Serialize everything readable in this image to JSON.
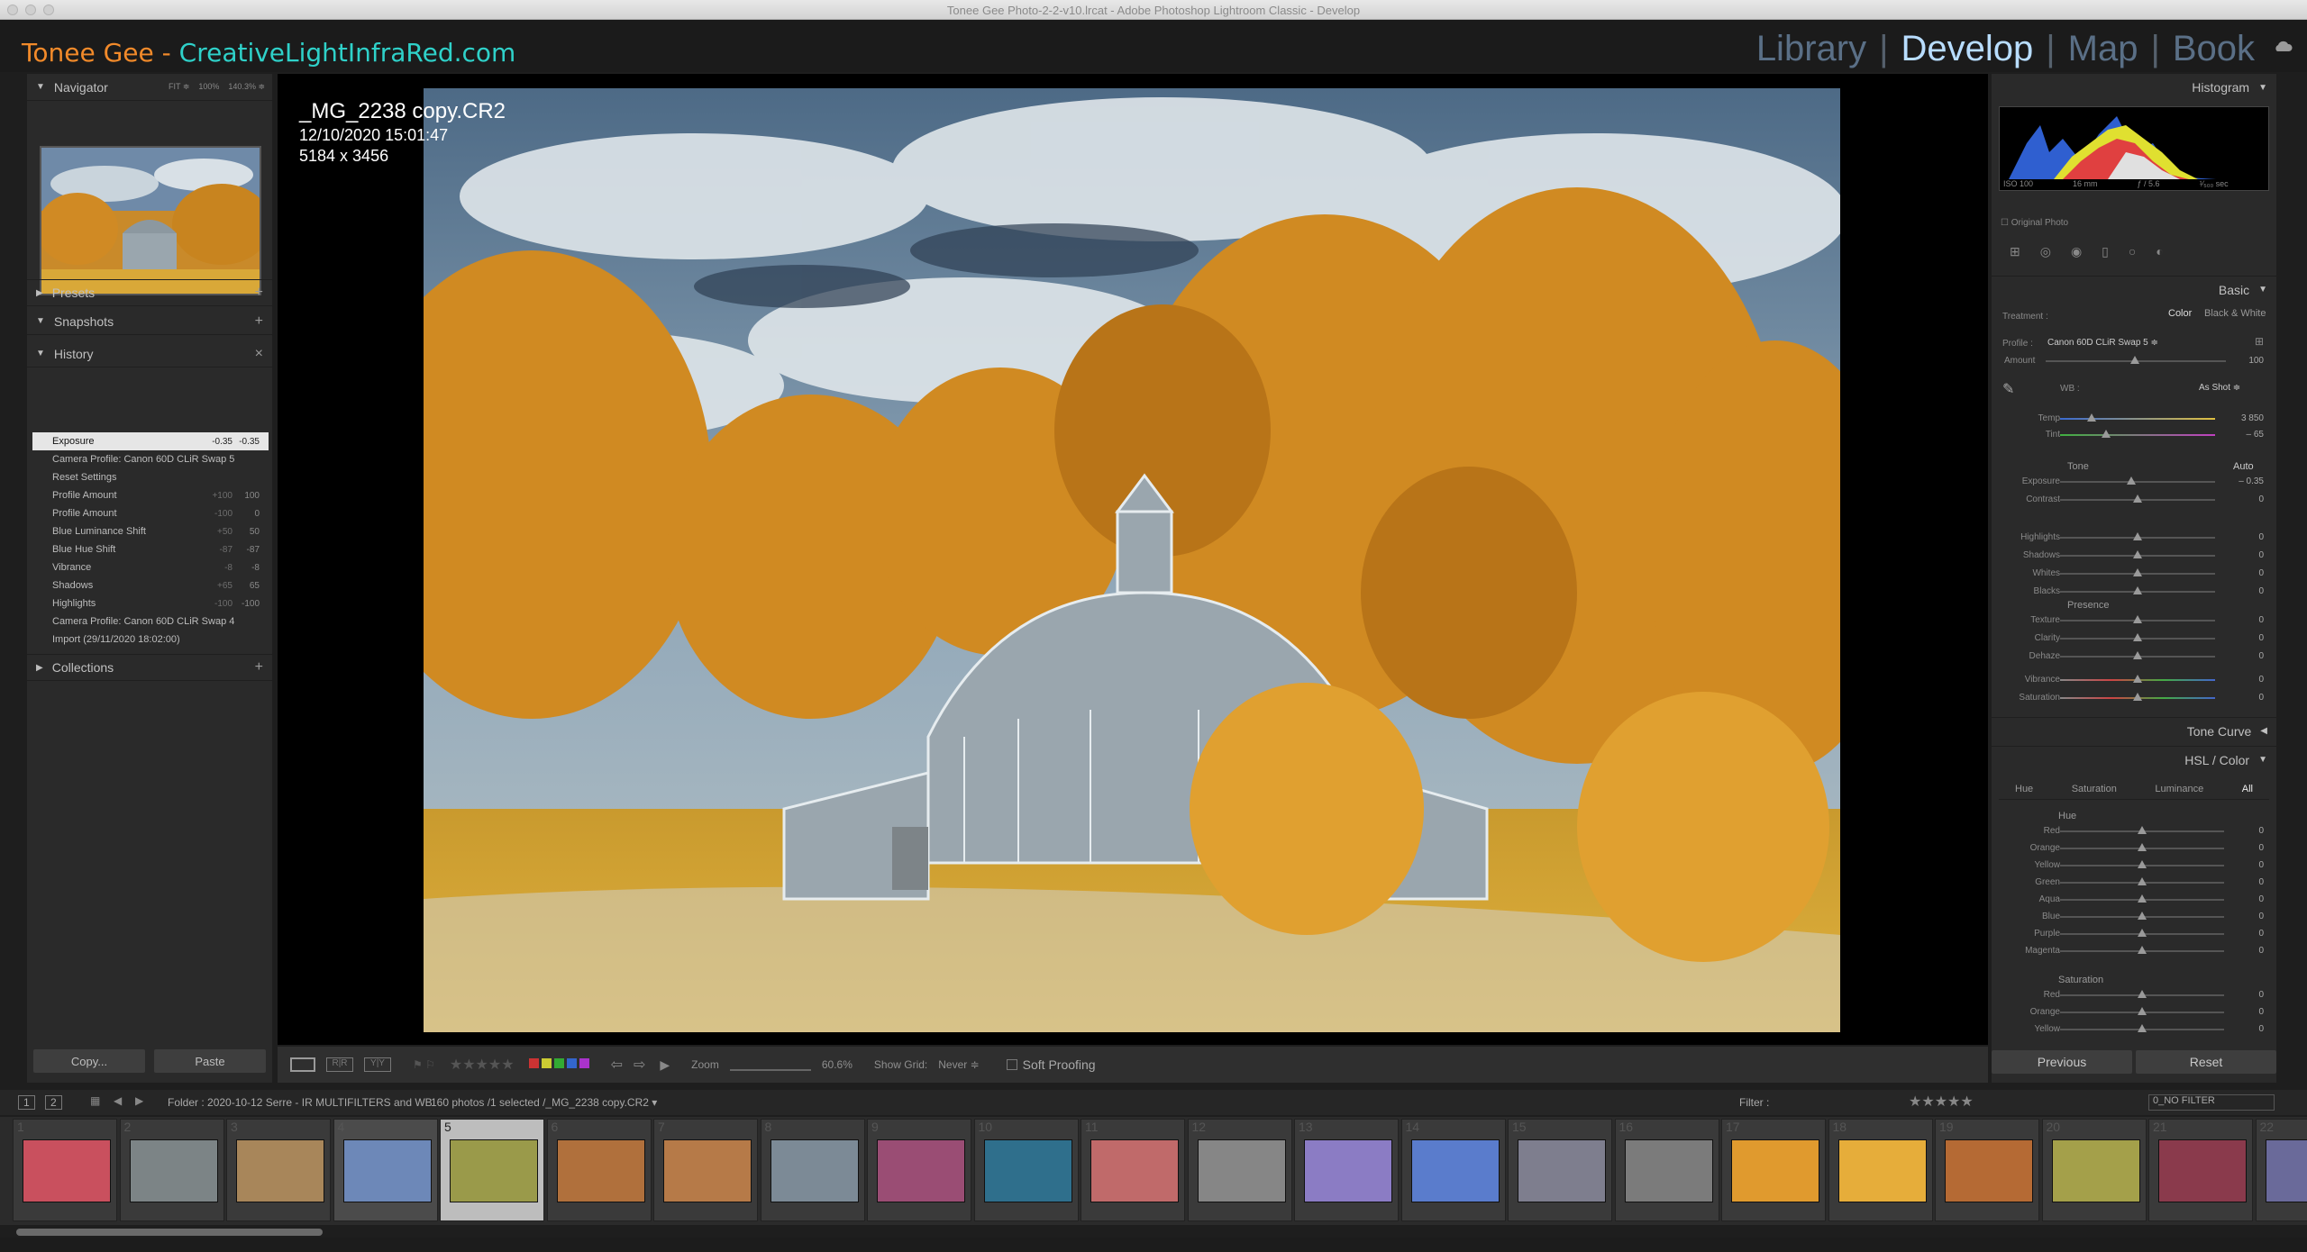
{
  "window": {
    "title": "Tonee Gee Photo-2-2-v10.lrcat - Adobe Photoshop Lightroom Classic - Develop"
  },
  "identity": {
    "brand_a": "Tonee Gee - ",
    "brand_b": "CreativeLightInfraRed.com"
  },
  "modules": {
    "library": "Library",
    "develop": "Develop",
    "map": "Map",
    "book": "Book",
    "active": "Develop"
  },
  "left": {
    "navigator": {
      "label": "Navigator",
      "zoom": [
        "FIT ≑",
        "100%",
        "140.3% ≑"
      ]
    },
    "presets": {
      "label": "Presets"
    },
    "snapshots": {
      "label": "Snapshots"
    },
    "history": {
      "label": "History",
      "items": [
        {
          "name": "Exposure",
          "v1": "-0.35",
          "v2": "-0.35"
        },
        {
          "name": "Camera Profile: Canon 60D CLiR Swap 5",
          "v1": "",
          "v2": ""
        },
        {
          "name": "Reset Settings",
          "v1": "",
          "v2": ""
        },
        {
          "name": "Profile Amount",
          "v1": "+100",
          "v2": "100"
        },
        {
          "name": "Profile Amount",
          "v1": "-100",
          "v2": "0"
        },
        {
          "name": "Blue Luminance Shift",
          "v1": "+50",
          "v2": "50"
        },
        {
          "name": "Blue Hue Shift",
          "v1": "-87",
          "v2": "-87"
        },
        {
          "name": "Vibrance",
          "v1": "-8",
          "v2": "-8"
        },
        {
          "name": "Shadows",
          "v1": "+65",
          "v2": "65"
        },
        {
          "name": "Highlights",
          "v1": "-100",
          "v2": "-100"
        },
        {
          "name": "Camera Profile: Canon 60D CLiR Swap 4",
          "v1": "",
          "v2": ""
        },
        {
          "name": "Import (29/11/2020 18:02:00)",
          "v1": "",
          "v2": ""
        }
      ]
    },
    "collections": {
      "label": "Collections"
    },
    "copy": "Copy...",
    "paste": "Paste"
  },
  "photo": {
    "name": "_MG_2238 copy.CR2",
    "date": "12/10/2020 15:01:47",
    "dims": "5184 x 3456"
  },
  "toolbar": {
    "zoom_label": "Zoom",
    "zoom_value": "60.6%",
    "grid_label": "Show Grid:",
    "grid_value": "Never ≑",
    "soft_proofing": "Soft Proofing"
  },
  "right": {
    "histogram": {
      "label": "Histogram",
      "iso": "ISO 100",
      "focal": "16 mm",
      "aperture": "ƒ / 5.6",
      "shutter": "¹⁄₅₀₀ sec",
      "original": "Original Photo"
    },
    "basic": {
      "label": "Basic",
      "treatment": "Treatment :",
      "color": "Color",
      "bw": "Black & White",
      "profile_label": "Profile :",
      "profile": "Canon 60D CLiR Swap 5 ≑",
      "amount_label": "Amount",
      "amount": "100",
      "wb_label": "WB :",
      "wb": "As Shot ≑",
      "temp_label": "Temp",
      "temp": "3 850",
      "tint_label": "Tint",
      "tint": "– 65",
      "tone": "Tone",
      "auto": "Auto",
      "presence": "Presence",
      "sliders": [
        {
          "label": "Exposure",
          "value": "– 0.35",
          "pos": 0.46
        },
        {
          "label": "Contrast",
          "value": "0",
          "pos": 0.5
        },
        {
          "label": "Highlights",
          "value": "0",
          "pos": 0.5
        },
        {
          "label": "Shadows",
          "value": "0",
          "pos": 0.5
        },
        {
          "label": "Whites",
          "value": "0",
          "pos": 0.5
        },
        {
          "label": "Blacks",
          "value": "0",
          "pos": 0.5
        }
      ],
      "presence_sliders": [
        {
          "label": "Texture",
          "value": "0",
          "pos": 0.5
        },
        {
          "label": "Clarity",
          "value": "0",
          "pos": 0.5
        },
        {
          "label": "Dehaze",
          "value": "0",
          "pos": 0.5
        },
        {
          "label": "Vibrance",
          "value": "0",
          "pos": 0.5
        },
        {
          "label": "Saturation",
          "value": "0",
          "pos": 0.5
        }
      ]
    },
    "tone_curve": {
      "label": "Tone Curve"
    },
    "hsl": {
      "label": "HSL / Color",
      "tabs": [
        "Hue",
        "Saturation",
        "Luminance",
        "All"
      ],
      "hue": "Hue",
      "saturation": "Saturation",
      "hue_sliders": [
        {
          "label": "Red",
          "value": "0",
          "color": "#d44"
        },
        {
          "label": "Orange",
          "value": "0",
          "color": "#d84"
        },
        {
          "label": "Yellow",
          "value": "0",
          "color": "#cc4"
        },
        {
          "label": "Green",
          "value": "0",
          "color": "#4a4"
        },
        {
          "label": "Aqua",
          "value": "0",
          "color": "#4ab"
        },
        {
          "label": "Blue",
          "value": "0",
          "color": "#46c"
        },
        {
          "label": "Purple",
          "value": "0",
          "color": "#84c"
        },
        {
          "label": "Magenta",
          "value": "0",
          "color": "#c4a"
        }
      ],
      "sat_sliders": [
        {
          "label": "Red",
          "value": "0",
          "color": "#d44"
        },
        {
          "label": "Orange",
          "value": "0",
          "color": "#d84"
        },
        {
          "label": "Yellow",
          "value": "0",
          "color": "#cc4"
        }
      ]
    },
    "previous": "Previous",
    "reset": "Reset"
  },
  "filmhdr": {
    "page1": "1",
    "page2": "2",
    "folder": "Folder : 2020-10-12 Serre - IR MULTIFILTERS and WB",
    "count": "160 photos /1 selected /_MG_2238 copy.CR2 ▾",
    "filter": "Filter :",
    "nofilter": "0_NO FILTER"
  },
  "filmstrip": [
    {
      "n": "1",
      "c": "#c9505e"
    },
    {
      "n": "2",
      "c": "#7c8486"
    },
    {
      "n": "3",
      "c": "#a8865a"
    },
    {
      "n": "4",
      "c": "#6d88b8"
    },
    {
      "n": "5",
      "c": "#9a9a4a"
    },
    {
      "n": "6",
      "c": "#b0703c"
    },
    {
      "n": "7",
      "c": "#b67a48"
    },
    {
      "n": "8",
      "c": "#7c8a96"
    },
    {
      "n": "9",
      "c": "#9a4d74"
    },
    {
      "n": "10",
      "c": "#2f6f8c"
    },
    {
      "n": "11",
      "c": "#c06a6a"
    },
    {
      "n": "12",
      "c": "#868686"
    },
    {
      "n": "13",
      "c": "#8b7cc4"
    },
    {
      "n": "14",
      "c": "#5a7ccc"
    },
    {
      "n": "15",
      "c": "#7e7e8e"
    },
    {
      "n": "16",
      "c": "#7b7b7b"
    },
    {
      "n": "17",
      "c": "#e09a2e"
    },
    {
      "n": "18",
      "c": "#e6ad3a"
    },
    {
      "n": "19",
      "c": "#b56a34"
    },
    {
      "n": "20",
      "c": "#a4a04a"
    },
    {
      "n": "21",
      "c": "#8a3a4c"
    },
    {
      "n": "22",
      "c": "#6a6a9a"
    }
  ]
}
